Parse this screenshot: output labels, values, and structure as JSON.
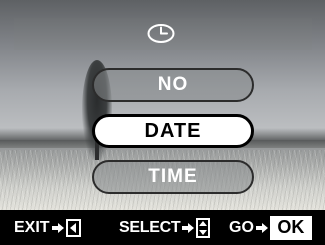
{
  "menu": {
    "header_icon": "clock-icon",
    "options": [
      {
        "label": "NO",
        "selected": false
      },
      {
        "label": "DATE",
        "selected": true
      },
      {
        "label": "TIME",
        "selected": false
      }
    ]
  },
  "bottom_bar": {
    "exit_label": "EXIT",
    "exit_key_icon": "left-arrow-key-icon",
    "select_label": "SELECT",
    "select_key_icon": "up-down-key-icon",
    "go_label": "GO",
    "ok_label": "OK"
  },
  "colors": {
    "highlight": "#ffffff",
    "text_on_highlight": "#000000",
    "text": "#ffffff"
  }
}
